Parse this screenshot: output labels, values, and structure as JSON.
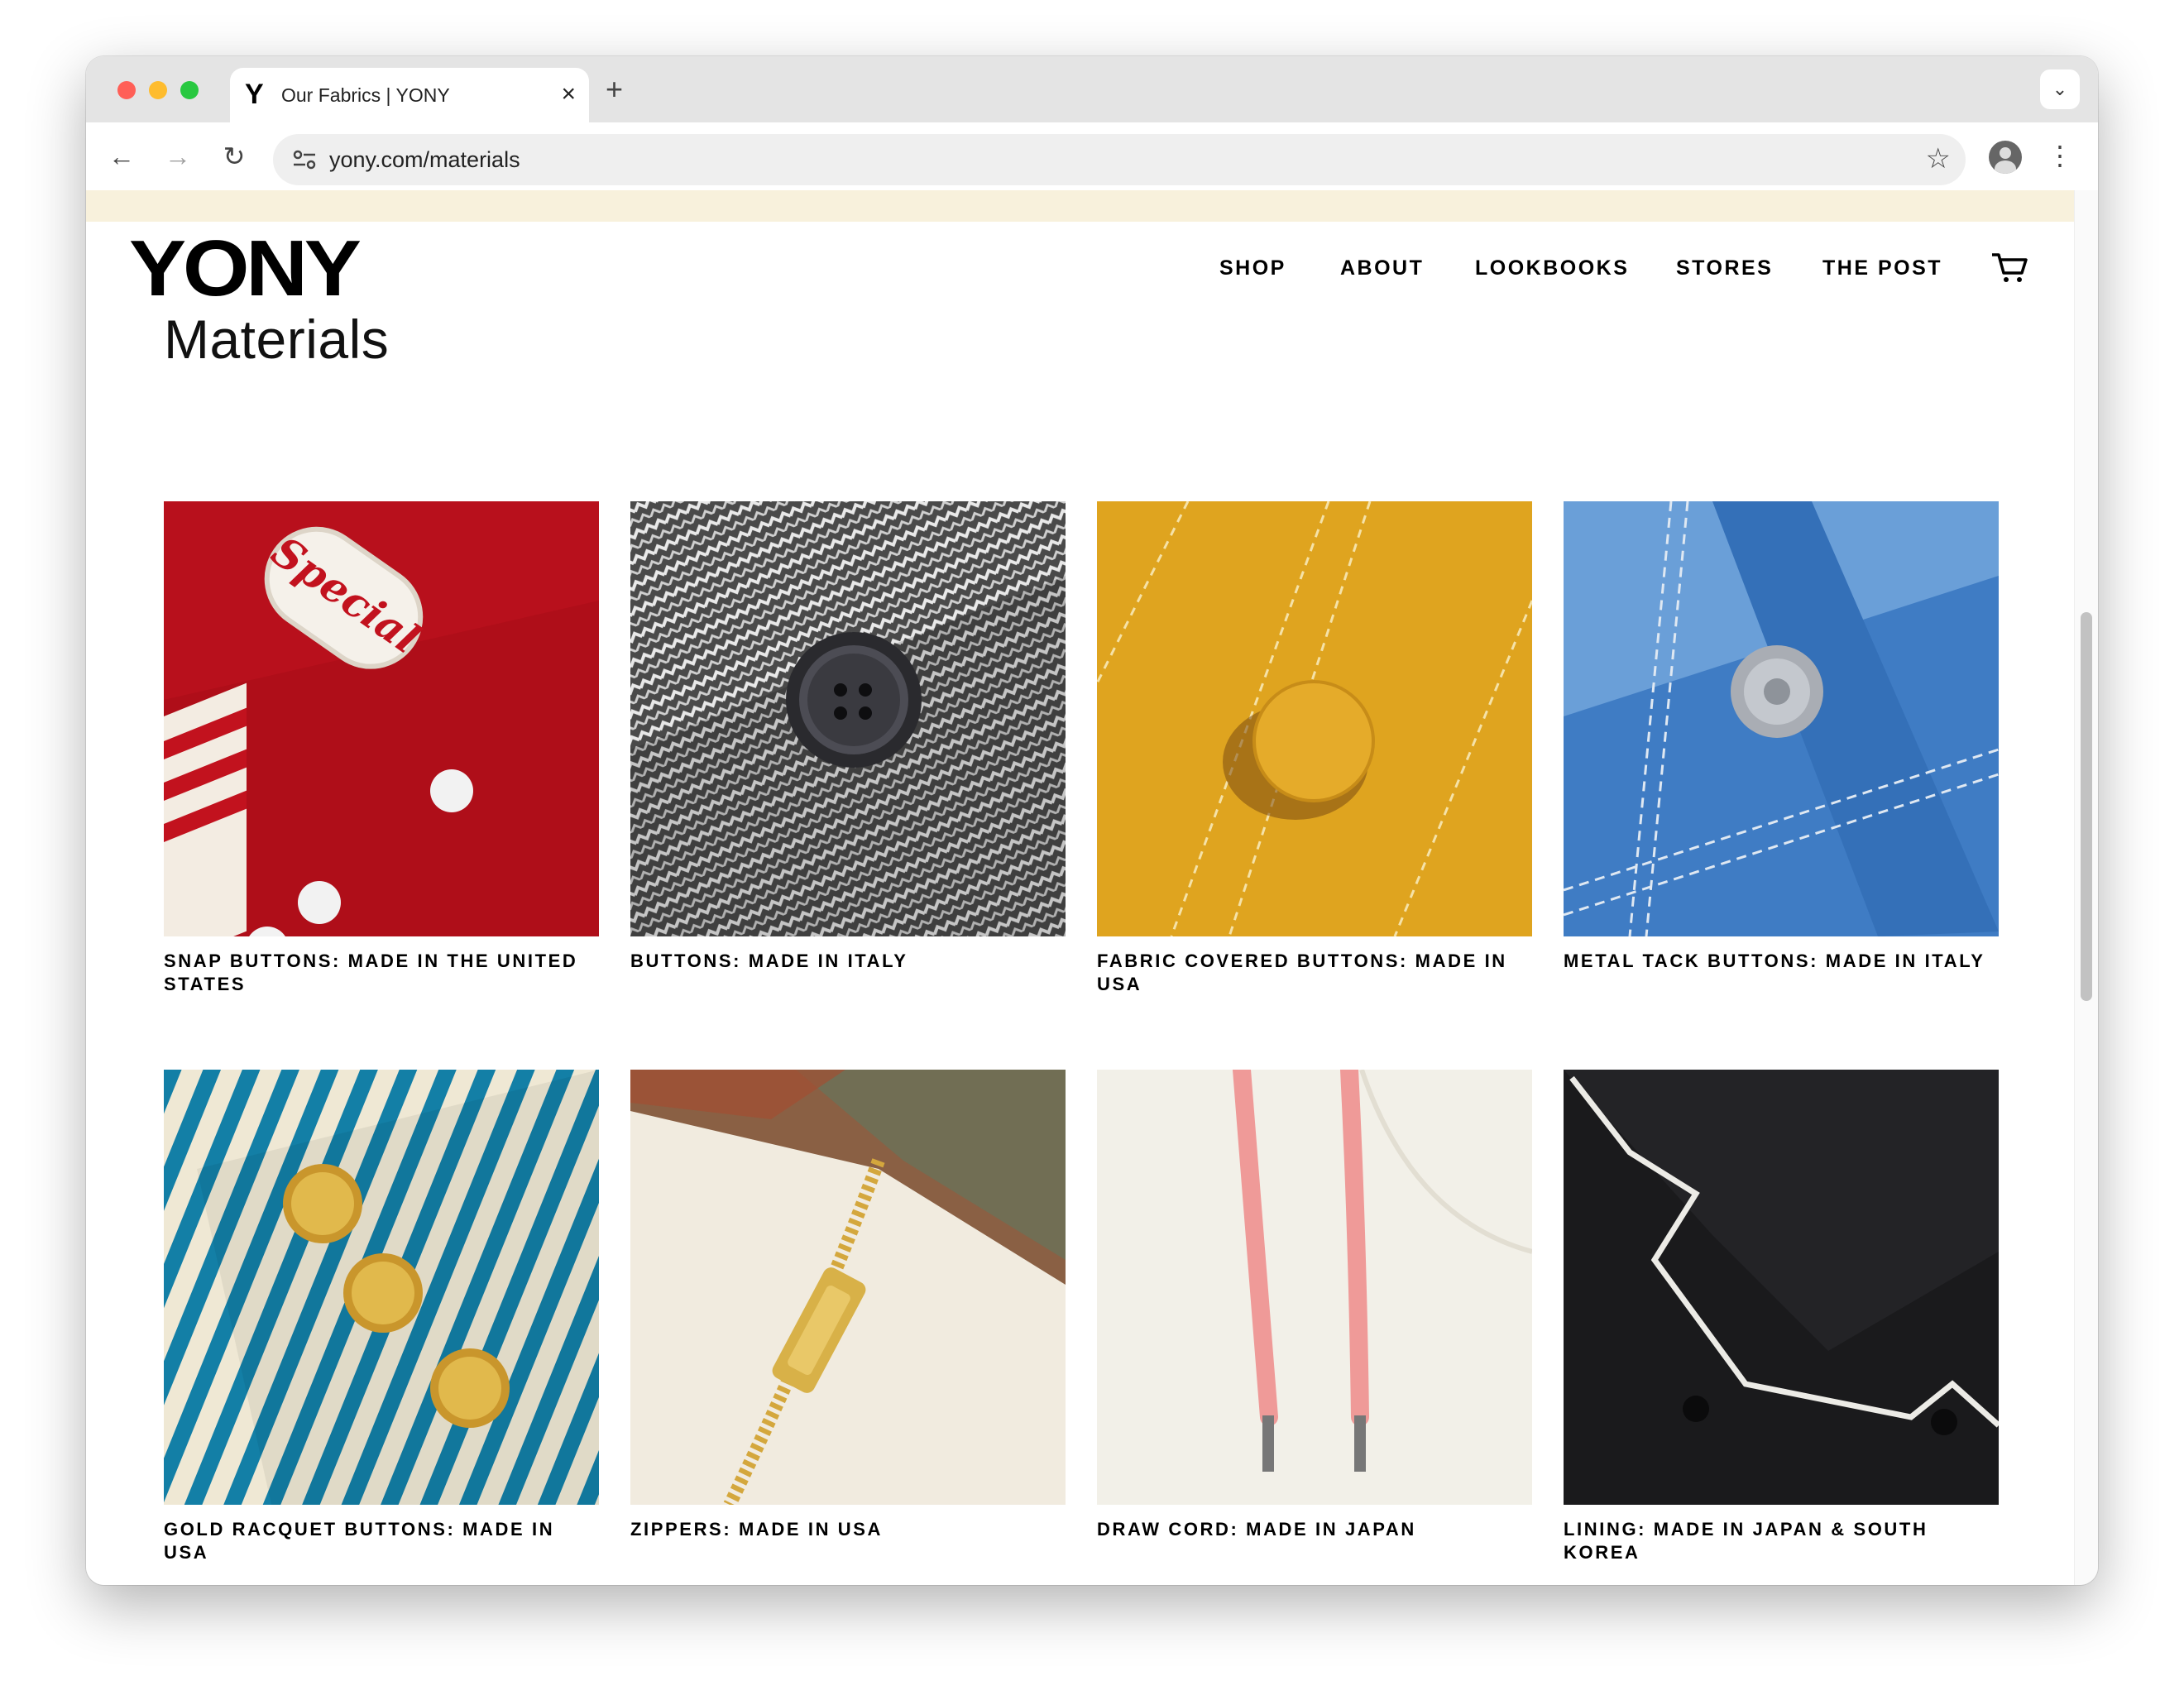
{
  "browser": {
    "tab_title": "Our Fabrics | YONY",
    "tab_favicon": "Y",
    "url": "yony.com/materials",
    "icons": [
      "back-icon",
      "forward-icon",
      "reload-icon",
      "site-info-icon",
      "bookmark-star-icon",
      "profile-icon",
      "menu-kebab-icon",
      "tab-close-icon",
      "new-tab-icon",
      "tab-list-icon"
    ]
  },
  "site": {
    "logo": "YONY",
    "nav": [
      "SHOP",
      "ABOUT",
      "LOOKBOOKS",
      "STORES",
      "THE POST"
    ],
    "cart_icon": "cart-icon",
    "announcement_bar_color": "#f8f1dc"
  },
  "page": {
    "title": "Materials",
    "items": [
      {
        "caption": "SNAP BUTTONS: MADE IN THE UNITED STATES",
        "image": "red varsity jacket with snap buttons and Special patch"
      },
      {
        "caption": "BUTTONS: MADE IN ITALY",
        "image": "herringbone tweed with dark button"
      },
      {
        "caption": "FABRIC COVERED BUTTONS: MADE IN USA",
        "image": "mustard fabric with fabric covered button"
      },
      {
        "caption": "METAL TACK BUTTONS: MADE IN ITALY",
        "image": "denim waistband with metal tack button"
      },
      {
        "caption": "GOLD RACQUET BUTTONS: MADE IN USA",
        "image": "blue striped fabric with gold racquet buttons"
      },
      {
        "caption": "ZIPPERS: MADE IN USA",
        "image": "sherpa lining with gold zipper"
      },
      {
        "caption": "DRAW CORD: MADE IN JAPAN",
        "image": "cream fabric with pink draw cord"
      },
      {
        "caption": "LINING: MADE IN JAPAN & SOUTH KOREA",
        "image": "black shirt collar with white piping"
      }
    ]
  }
}
